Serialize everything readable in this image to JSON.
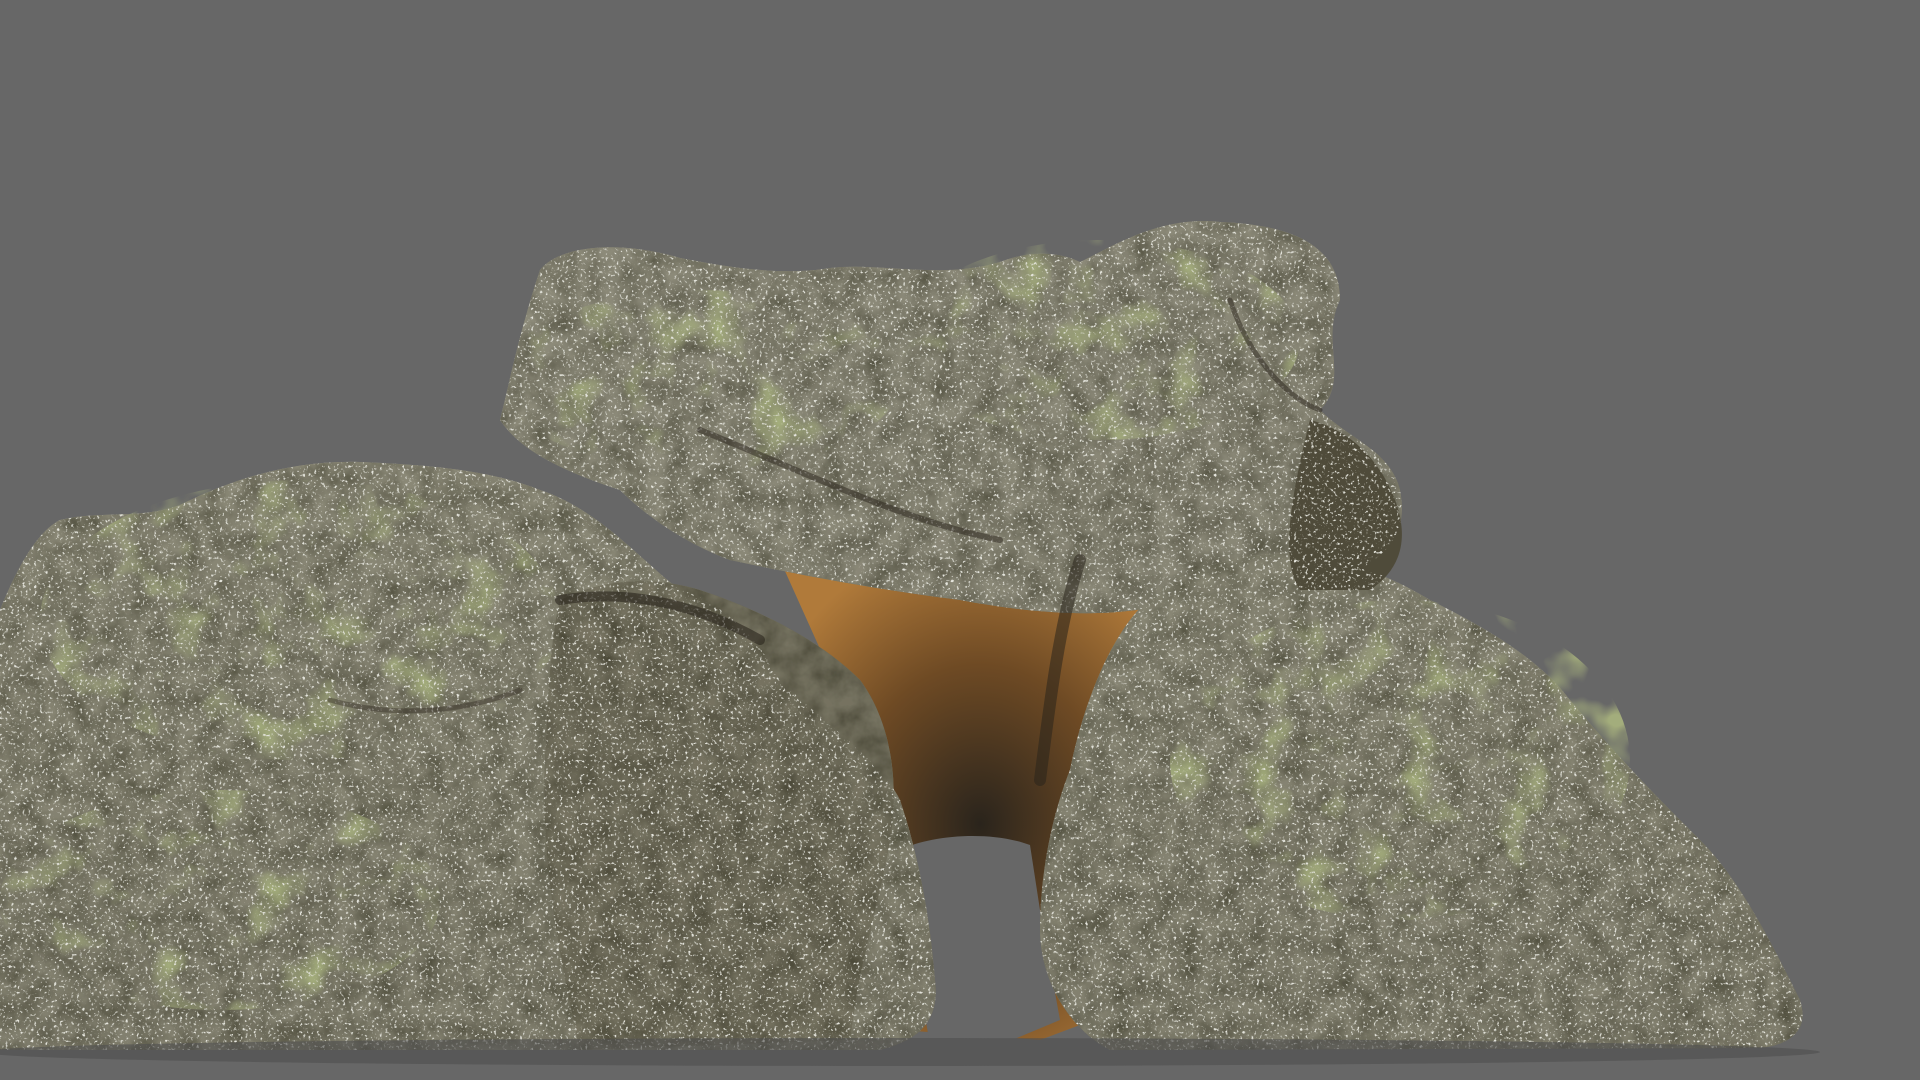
{
  "scene": {
    "subject": "rock-arch-model",
    "colors": {
      "background": "#676767",
      "rock_base": "#4a4638",
      "rock_light": "#8f8d7c",
      "moss": "#5f6a35",
      "cave_interior": "#b07a3a",
      "cave_shadow": "#2a241c"
    }
  }
}
